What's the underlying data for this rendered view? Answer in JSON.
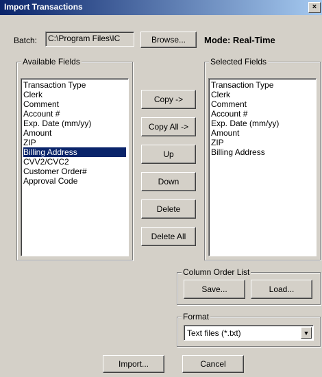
{
  "window": {
    "title": "Import Transactions",
    "close_glyph": "×"
  },
  "batch": {
    "label": "Batch:",
    "value": "C:\\Program Files\\IC",
    "browse_label": "Browse..."
  },
  "mode": {
    "text": "Mode: Real-Time"
  },
  "available": {
    "legend": "Available Fields",
    "items": [
      "Transaction Type",
      "Clerk",
      "Comment",
      "Account #",
      "Exp. Date (mm/yy)",
      "Amount",
      "ZIP",
      "Billing Address",
      "CVV2/CVC2",
      "Customer Order#",
      "Approval Code"
    ],
    "selected_index": 7
  },
  "selected": {
    "legend": "Selected Fields",
    "items": [
      "Transaction Type",
      "Clerk",
      "Comment",
      "Account #",
      "Exp. Date (mm/yy)",
      "Amount",
      "ZIP",
      "Billing Address"
    ]
  },
  "actions": {
    "copy": "Copy ->",
    "copy_all": "Copy All ->",
    "up": "Up",
    "down": "Down",
    "delete": "Delete",
    "delete_all": "Delete All"
  },
  "column_order": {
    "legend": "Column Order List",
    "save": "Save...",
    "load": "Load..."
  },
  "format": {
    "legend": "Format",
    "value": "Text files (*.txt)",
    "arrow_glyph": "▼"
  },
  "footer": {
    "import": "Import...",
    "cancel": "Cancel"
  }
}
